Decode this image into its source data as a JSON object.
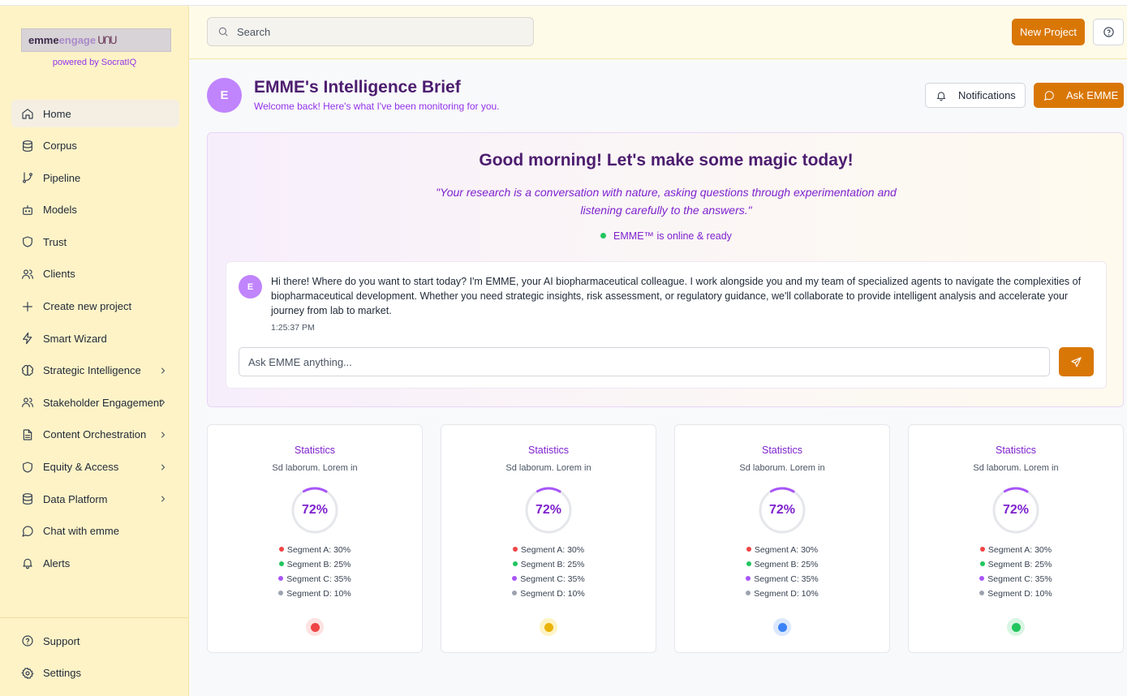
{
  "brand": {
    "logo_part1": "emme",
    "logo_part2": "engage",
    "powered_by": "powered by SocratIQ"
  },
  "sidebar": {
    "items": [
      {
        "label": "Home",
        "icon": "home-icon",
        "active": true,
        "has_chevron": false
      },
      {
        "label": "Corpus",
        "icon": "database-icon",
        "has_chevron": false
      },
      {
        "label": "Pipeline",
        "icon": "git-branch-icon",
        "has_chevron": false
      },
      {
        "label": "Models",
        "icon": "bot-icon",
        "has_chevron": false
      },
      {
        "label": "Trust",
        "icon": "shield-icon",
        "has_chevron": false
      },
      {
        "label": "Clients",
        "icon": "users-icon",
        "has_chevron": false
      },
      {
        "label": "Create new project",
        "icon": "plus-icon",
        "has_chevron": false
      },
      {
        "label": "Smart Wizard",
        "icon": "zap-icon",
        "has_chevron": false
      },
      {
        "label": "Strategic Intelligence",
        "icon": "brain-icon",
        "has_chevron": true
      },
      {
        "label": "Stakeholder Engagement",
        "icon": "users-icon",
        "has_chevron": true
      },
      {
        "label": "Content Orchestration",
        "icon": "file-text-icon",
        "has_chevron": true
      },
      {
        "label": "Equity & Access",
        "icon": "shield-icon",
        "has_chevron": true
      },
      {
        "label": "Data Platform",
        "icon": "database-icon",
        "has_chevron": true
      },
      {
        "label": "Chat with emme",
        "icon": "message-circle-icon",
        "has_chevron": false
      },
      {
        "label": "Alerts",
        "icon": "bell-icon",
        "has_chevron": false
      }
    ],
    "bottom_items": [
      {
        "label": "Support",
        "icon": "help-circle-icon"
      },
      {
        "label": "Settings",
        "icon": "gear-icon"
      }
    ]
  },
  "header": {
    "search_placeholder": "Search",
    "new_project_label": "New Project",
    "help_icon": "help-circle-icon"
  },
  "brief": {
    "avatar_letter": "E",
    "title": "EMME's Intelligence Brief",
    "subtitle": "Welcome back! Here's what I've been monitoring for you.",
    "notifications_label": "Notifications",
    "ask_label": "Ask EMME"
  },
  "greeting": {
    "headline": "Good morning! Let's make some magic today!",
    "quote": "\"Your research is a conversation with nature, asking questions through experimentation and listening carefully to the answers.\"",
    "status": "EMME™ is online & ready",
    "status_color": "#22c55e"
  },
  "chat": {
    "avatar_letter": "E",
    "message": "Hi there! Where do you want to start today? I'm EMME, your AI biopharmaceutical colleague. I work alongside you and my team of specialized agents to navigate the complexities of biopharmaceutical development. Whether you need strategic insights, risk assessment, or regulatory guidance, we'll collaborate to provide intelligent analysis and accelerate your journey from lab to market.",
    "time": "1:25:37 PM",
    "input_placeholder": "Ask EMME anything...",
    "send_icon": "send-icon"
  },
  "cards": [
    {
      "title": "Statistics",
      "subtitle": "Sd laborum. Lorem in",
      "percent": "72%",
      "progress": 0.72,
      "segments": [
        {
          "label": "Segment A: 30%",
          "color": "#ef4444"
        },
        {
          "label": "Segment B: 25%",
          "color": "#22c55e"
        },
        {
          "label": "Segment C: 35%",
          "color": "#a855f7"
        },
        {
          "label": "Segment D: 10%",
          "color": "#9ca3af"
        }
      ],
      "status_color": "#ef4444",
      "status_bg": "#fde2e2"
    },
    {
      "title": "Statistics",
      "subtitle": "Sd laborum. Lorem in",
      "percent": "72%",
      "progress": 0.72,
      "segments": [
        {
          "label": "Segment A: 30%",
          "color": "#ef4444"
        },
        {
          "label": "Segment B: 25%",
          "color": "#22c55e"
        },
        {
          "label": "Segment C: 35%",
          "color": "#a855f7"
        },
        {
          "label": "Segment D: 10%",
          "color": "#9ca3af"
        }
      ],
      "status_color": "#eab308",
      "status_bg": "#fdf3c4"
    },
    {
      "title": "Statistics",
      "subtitle": "Sd laborum. Lorem in",
      "percent": "72%",
      "progress": 0.72,
      "segments": [
        {
          "label": "Segment A: 30%",
          "color": "#ef4444"
        },
        {
          "label": "Segment B: 25%",
          "color": "#22c55e"
        },
        {
          "label": "Segment C: 35%",
          "color": "#a855f7"
        },
        {
          "label": "Segment D: 10%",
          "color": "#9ca3af"
        }
      ],
      "status_color": "#3b82f6",
      "status_bg": "#dbe8fd"
    },
    {
      "title": "Statistics",
      "subtitle": "Sd laborum. Lorem in",
      "percent": "72%",
      "progress": 0.72,
      "segments": [
        {
          "label": "Segment A: 30%",
          "color": "#ef4444"
        },
        {
          "label": "Segment B: 25%",
          "color": "#22c55e"
        },
        {
          "label": "Segment C: 35%",
          "color": "#a855f7"
        },
        {
          "label": "Segment D: 10%",
          "color": "#9ca3af"
        }
      ],
      "status_color": "#22c55e",
      "status_bg": "#d9f5e3"
    }
  ],
  "colors": {
    "accent": "#d97706",
    "brand_purple": "#7e22ce",
    "sidebar_bg": "#fef3c7"
  }
}
